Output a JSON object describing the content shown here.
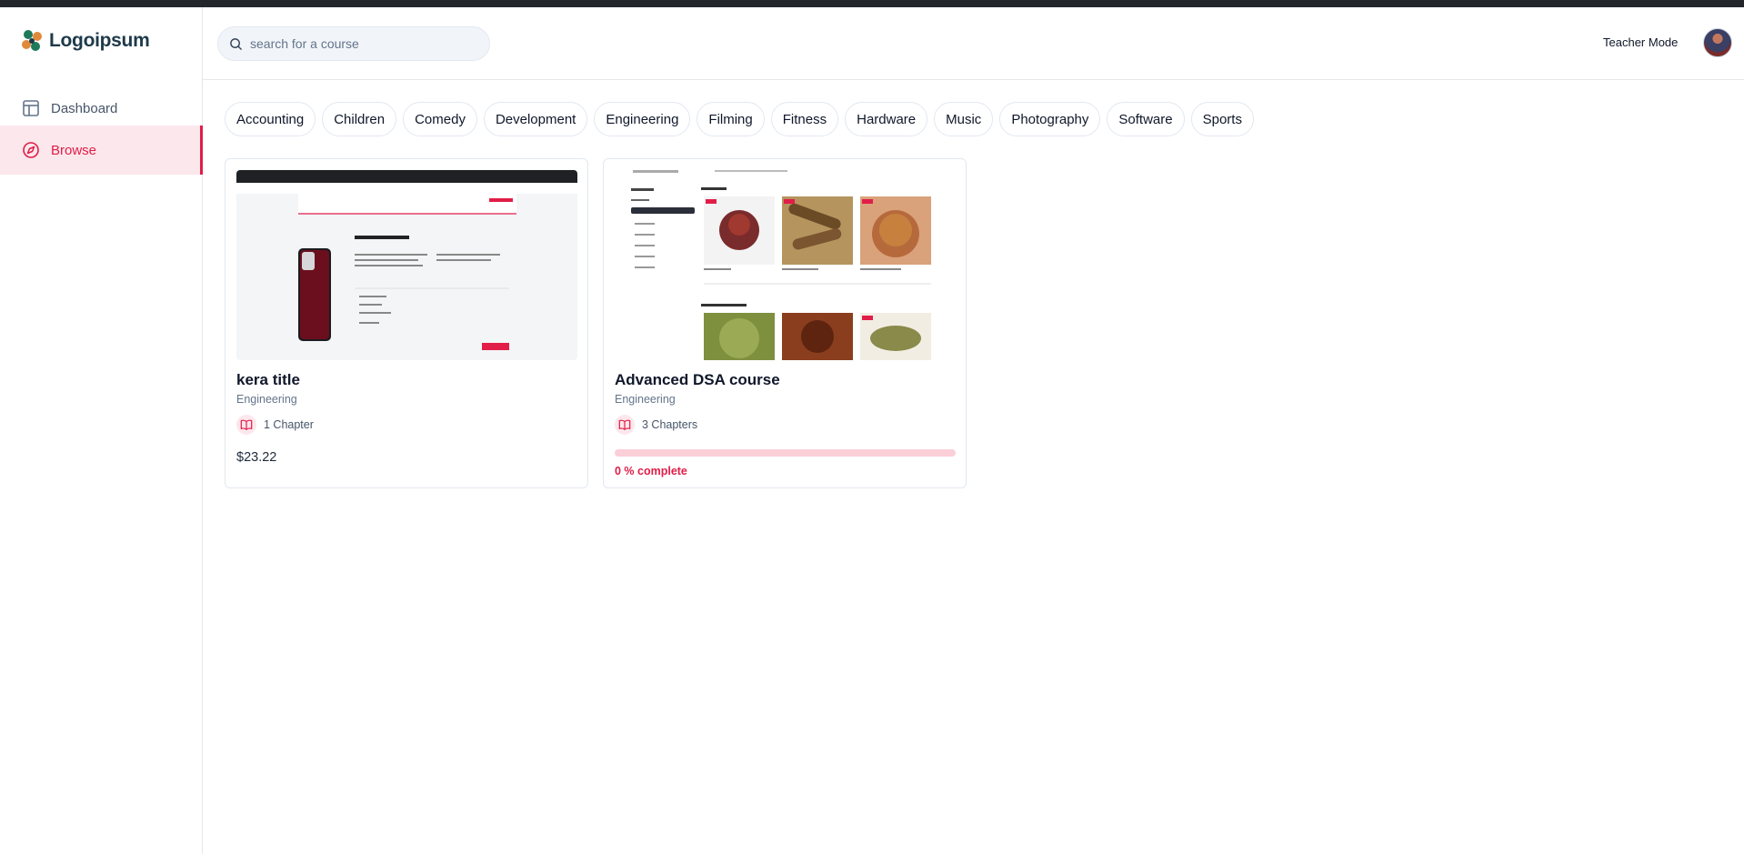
{
  "app": {
    "logo_text": "Logoipsum",
    "brand_color": "#e11d48"
  },
  "sidebar": {
    "items": [
      {
        "label": "Dashboard",
        "icon": "layout-icon",
        "active": false
      },
      {
        "label": "Browse",
        "icon": "compass-icon",
        "active": true
      }
    ]
  },
  "header": {
    "search_placeholder": "search for a course",
    "teacher_mode_label": "Teacher Mode"
  },
  "categories": [
    "Accounting",
    "Children",
    "Comedy",
    "Development",
    "Engineering",
    "Filming",
    "Fitness",
    "Hardware",
    "Music",
    "Photography",
    "Software",
    "Sports"
  ],
  "courses": [
    {
      "title": "kera title",
      "category": "Engineering",
      "chapters": "1 Chapter",
      "price": "$23.22"
    },
    {
      "title": "Advanced DSA course",
      "category": "Engineering",
      "chapters": "3 Chapters",
      "progress_percent": 0,
      "progress_text": "0 % complete"
    }
  ]
}
